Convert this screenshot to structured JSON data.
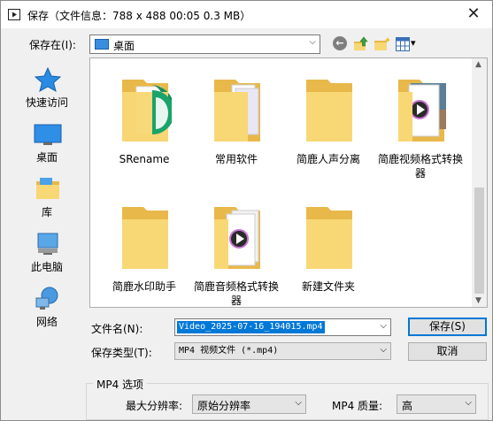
{
  "window": {
    "title": "保存（文件信息：788 x 488    00:05    0.3 MB）",
    "close_glyph": "✕"
  },
  "save_in": {
    "label": "保存在(I):",
    "value": "桌面",
    "arrow": "⌵"
  },
  "toolbar": {
    "back_glyph": "←",
    "view_arrow": "▾"
  },
  "places": [
    {
      "label": "快速访问",
      "icon": "star-icon"
    },
    {
      "label": "桌面",
      "icon": "desktop-icon"
    },
    {
      "label": "库",
      "icon": "library-icon"
    },
    {
      "label": "此电脑",
      "icon": "computer-icon"
    },
    {
      "label": "网络",
      "icon": "network-icon"
    }
  ],
  "files": [
    {
      "name": "SRename",
      "icon": "folder-green-icon"
    },
    {
      "name": "常用软件",
      "icon": "folder-docs-icon"
    },
    {
      "name": "简鹿人声分离",
      "icon": "folder-icon"
    },
    {
      "name": "简鹿视频格式转换器",
      "icon": "folder-video-icon"
    },
    {
      "name": "简鹿水印助手",
      "icon": "folder-icon"
    },
    {
      "name": "简鹿音频格式转换器",
      "icon": "folder-audio-icon"
    },
    {
      "name": "新建文件夹",
      "icon": "folder-icon"
    }
  ],
  "filename": {
    "label": "文件名(N):",
    "value": "Video_2025-07-16_194015.mp4"
  },
  "filetype": {
    "label": "保存类型(T):",
    "value": "MP4 视频文件 (*.mp4)"
  },
  "buttons": {
    "save": "保存(S)",
    "cancel": "取消"
  },
  "options": {
    "title": "MP4 选项",
    "resolution_label": "最大分辨率:",
    "resolution_value": "原始分辨率",
    "quality_label": "MP4 质量:",
    "quality_value": "高"
  },
  "colors": {
    "accent": "#0078d7",
    "folder": "#f8d775",
    "folder_dark": "#e8b84a"
  }
}
